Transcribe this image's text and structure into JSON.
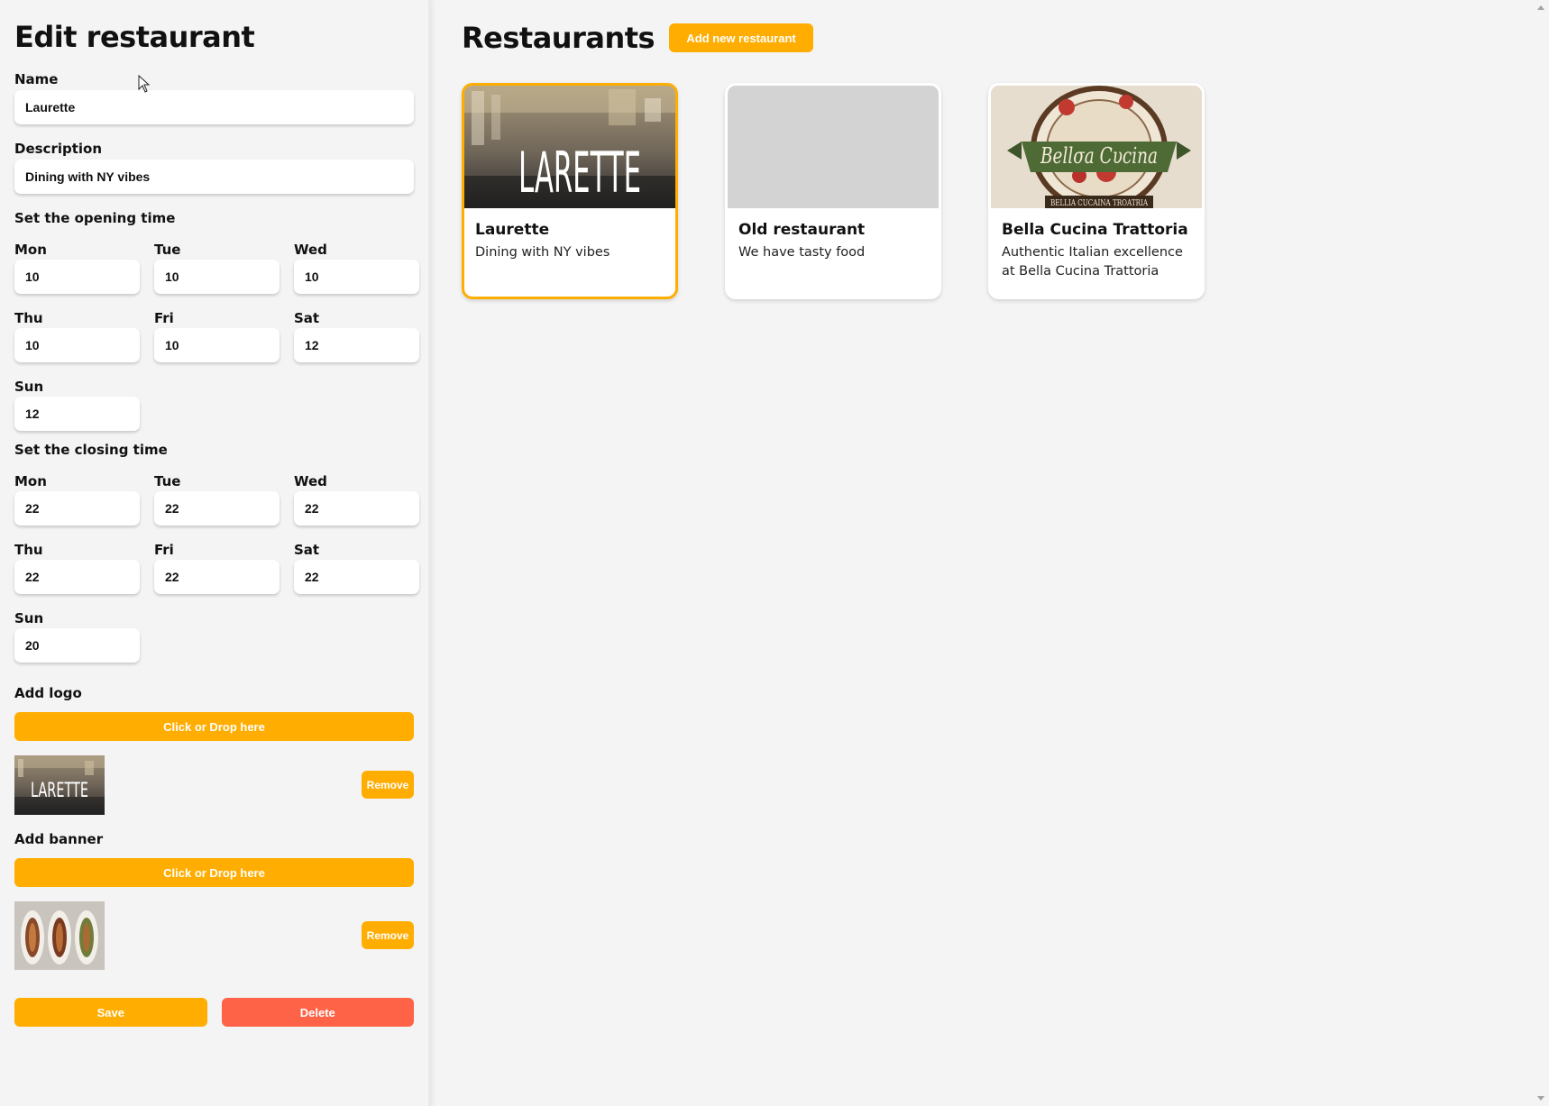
{
  "edit_panel": {
    "title": "Edit restaurant",
    "name_label": "Name",
    "name_value": "Laurette",
    "description_label": "Description",
    "description_value": "Dining with NY vibes",
    "opening_heading": "Set the opening time",
    "opening_days": [
      {
        "label": "Mon",
        "value": "10"
      },
      {
        "label": "Tue",
        "value": "10"
      },
      {
        "label": "Wed",
        "value": "10"
      },
      {
        "label": "Thu",
        "value": "10"
      },
      {
        "label": "Fri",
        "value": "10"
      },
      {
        "label": "Sat",
        "value": "12"
      },
      {
        "label": "Sun",
        "value": "12"
      }
    ],
    "closing_heading": "Set the closing time",
    "closing_days": [
      {
        "label": "Mon",
        "value": "22"
      },
      {
        "label": "Tue",
        "value": "22"
      },
      {
        "label": "Wed",
        "value": "22"
      },
      {
        "label": "Thu",
        "value": "22"
      },
      {
        "label": "Fri",
        "value": "22"
      },
      {
        "label": "Sat",
        "value": "22"
      },
      {
        "label": "Sun",
        "value": "20"
      }
    ],
    "logo_heading": "Add logo",
    "logo_upload_label": "Click or Drop here",
    "logo_preview_text": "LARETTE",
    "logo_remove_label": "Remove",
    "banner_heading": "Add banner",
    "banner_upload_label": "Click or Drop here",
    "banner_remove_label": "Remove",
    "save_label": "Save",
    "delete_label": "Delete"
  },
  "main": {
    "title": "Restaurants",
    "add_button_label": "Add new restaurant",
    "restaurants": [
      {
        "name": "Laurette",
        "description": "Dining with NY vibes",
        "image_text": "LARETTE",
        "selected": true
      },
      {
        "name": "Old restaurant",
        "description": "We have tasty food",
        "image_text": "",
        "selected": false
      },
      {
        "name": "Bella Cucina Trattoria",
        "description": "Authentic Italian excellence at Bella Cucina Trattoria",
        "image_text": "Bellσa Cυcina",
        "image_subtext": "BELLIA CUCAINA TROATRIA",
        "selected": false
      }
    ]
  },
  "colors": {
    "accent": "#ffad00",
    "danger": "#ff6347",
    "background": "#f4f4f4",
    "card": "#ffffff",
    "placeholder_image": "#d3d3d3"
  },
  "icons": [
    "cursor-arrow-icon",
    "scroll-up-icon",
    "scroll-down-icon"
  ]
}
